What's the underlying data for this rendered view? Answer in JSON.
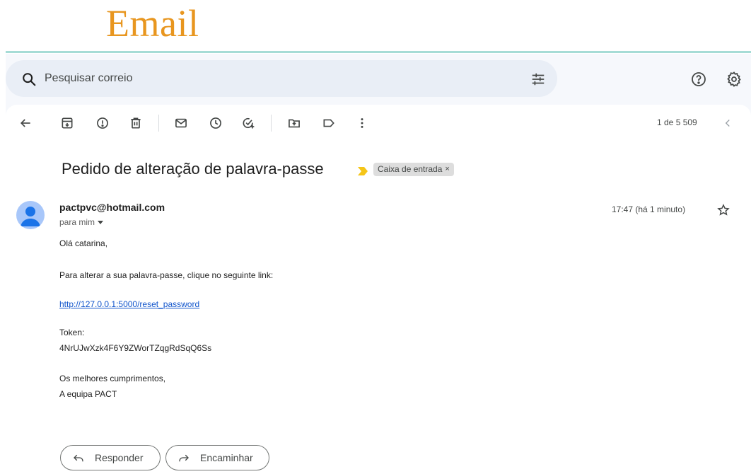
{
  "page": {
    "heading": "Email",
    "accent_color": "#e8961f",
    "divider_color": "#a6dcd6"
  },
  "search": {
    "placeholder": "Pesquisar correio",
    "icon": "search-icon",
    "filter_icon": "tune-icon"
  },
  "topbar": {
    "help_icon": "help-icon",
    "settings_icon": "gear-icon"
  },
  "toolbar": {
    "icons": [
      "back-arrow-icon",
      "archive-icon",
      "report-spam-icon",
      "delete-icon",
      "mark-unread-icon",
      "snooze-icon",
      "add-to-tasks-icon",
      "move-to-icon",
      "label-icon",
      "more-vert-icon"
    ],
    "pager": "1 de 5 509",
    "prev_icon": "chevron-left-icon"
  },
  "message": {
    "subject": "Pedido de alteração de palavra-passe",
    "important_marker_color": "#f5c518",
    "label_chip": "Caixa de entrada",
    "label_chip_close": "×",
    "sender": "pactpvc@hotmail.com",
    "recipient": "para mim",
    "time": "17:47 (há 1 minuto)",
    "body": {
      "greeting": "Olá catarina,",
      "instruction": "Para alterar a sua palavra-passe, clique no seguinte link:",
      "link": "http://127.0.0.1:5000/reset_password",
      "token_label": "Token:",
      "token_value": "4NrUJwXzk4F6Y9ZWorTZqgRdSqQ6Ss",
      "closing": "Os melhores cumprimentos,",
      "signature": "A equipa PACT"
    }
  },
  "actions": {
    "reply": "Responder",
    "forward": "Encaminhar"
  }
}
